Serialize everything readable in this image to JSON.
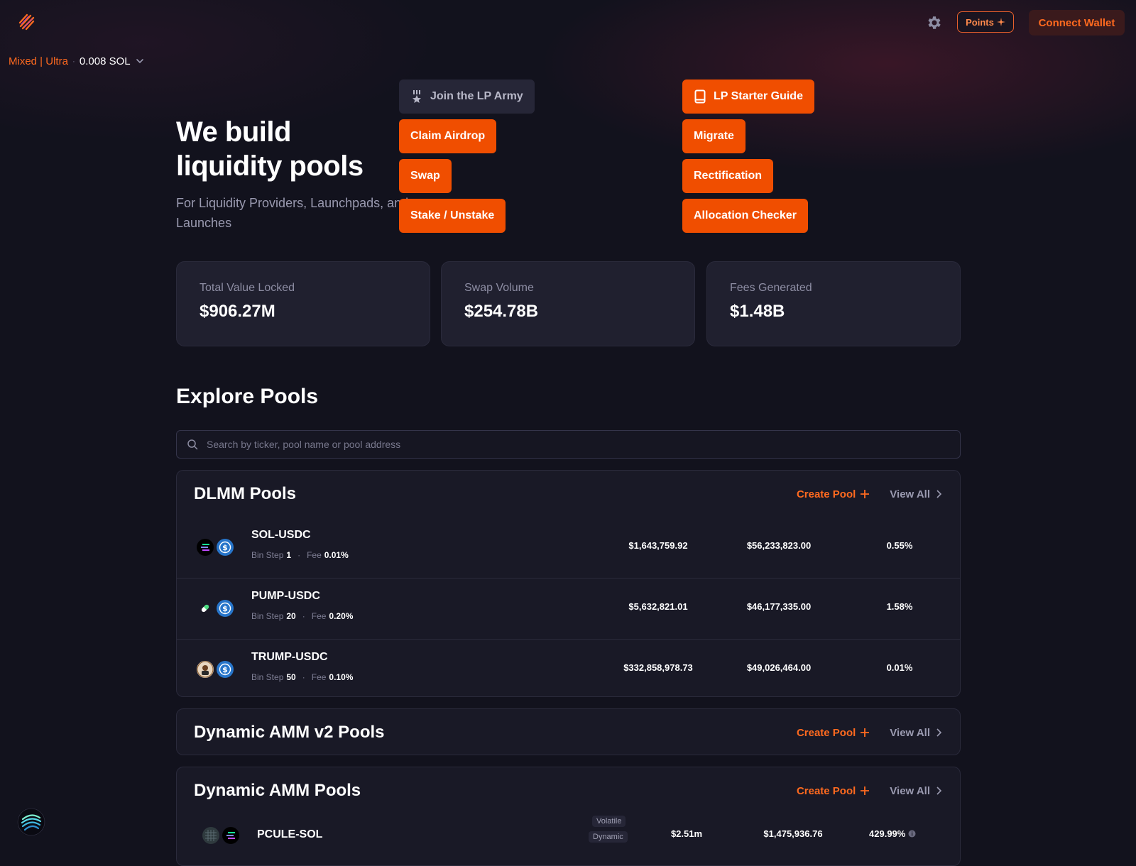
{
  "header": {
    "points_label": "Points",
    "connect_label": "Connect Wallet",
    "network_mode": "Mixed | Ultra",
    "network_sep": "·",
    "sol_balance": "0.008 SOL"
  },
  "hero": {
    "title_line1": "We build",
    "title_line2": "liquidity pools",
    "subtitle": "For Liquidity Providers, Launchpads, and Launches"
  },
  "actions": {
    "lp_army": "Join the LP Army",
    "lp_guide": "LP Starter Guide",
    "claim_airdrop": "Claim Airdrop",
    "migrate": "Migrate",
    "swap": "Swap",
    "rectification": "Rectification",
    "stake": "Stake / Unstake",
    "allocation": "Allocation Checker"
  },
  "stats": [
    {
      "label": "Total Value Locked",
      "value": "$906.27M"
    },
    {
      "label": "Swap Volume",
      "value": "$254.78B"
    },
    {
      "label": "Fees Generated",
      "value": "$1.48B"
    }
  ],
  "explore": {
    "title": "Explore Pools",
    "search_placeholder": "Search by ticker, pool name or pool address"
  },
  "panels": {
    "create_pool": "Create Pool",
    "view_all": "View All",
    "dlmm": {
      "title": "DLMM Pools",
      "bin_step_label": "Bin Step",
      "fee_label": "Fee",
      "rows": [
        {
          "pair": "SOL-USDC",
          "bin_step": "1",
          "fee": "0.01%",
          "liquidity": "$1,643,759.92",
          "volume": "$56,233,823.00",
          "apr": "0.55%"
        },
        {
          "pair": "PUMP-USDC",
          "bin_step": "20",
          "fee": "0.20%",
          "liquidity": "$5,632,821.01",
          "volume": "$46,177,335.00",
          "apr": "1.58%"
        },
        {
          "pair": "TRUMP-USDC",
          "bin_step": "50",
          "fee": "0.10%",
          "liquidity": "$332,858,978.73",
          "volume": "$49,026,464.00",
          "apr": "0.01%"
        }
      ]
    },
    "damm_v2": {
      "title": "Dynamic AMM v2 Pools"
    },
    "damm": {
      "title": "Dynamic AMM Pools",
      "rows": [
        {
          "pair": "PCULE-SOL",
          "tag1": "Volatile",
          "tag2": "Dynamic",
          "liquidity": "$2.51m",
          "volume": "$1,475,936.76",
          "apr": "429.99%"
        }
      ]
    }
  },
  "colors": {
    "accent": "#f04e00",
    "accent_text": "#ff6a1f",
    "background": "#12121d",
    "card": "#20202f"
  }
}
